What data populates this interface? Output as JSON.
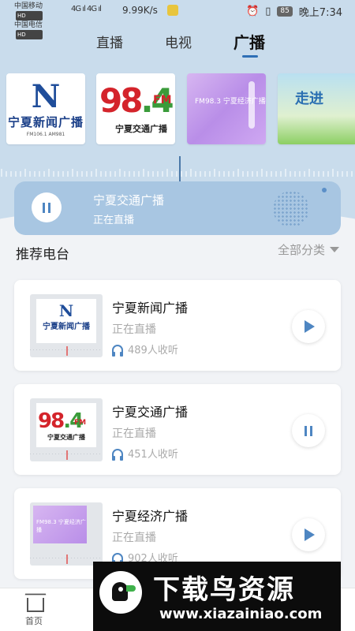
{
  "status_bar": {
    "carrier1": "中国移动",
    "carrier2": "中国电信",
    "hd": "HD",
    "signal": "4G ıl 4G ıl",
    "speed": "9.99K/s",
    "battery": "85",
    "time": "晚上7:34"
  },
  "tabs": [
    {
      "label": "直播"
    },
    {
      "label": "电视"
    },
    {
      "label": "广播",
      "active": true
    }
  ],
  "carousel": {
    "logo1": {
      "mark": "N",
      "text": "宁夏新闻广播",
      "sub": "FM106.1 AM981"
    },
    "logo2": {
      "num_a": "98",
      "num_b": ".4",
      "tag": "FM",
      "text": "宁夏交通广播"
    },
    "logo3": {
      "text": "FM98.3 宁夏经济广播"
    },
    "logo4": {
      "text": "走进"
    }
  },
  "now_playing": {
    "title": "宁夏交通广播",
    "status": "正在直播"
  },
  "section": {
    "title": "推荐电台",
    "filter": "全部分类"
  },
  "stations": [
    {
      "name": "宁夏新闻广播",
      "status": "正在直播",
      "listeners": "489人收听",
      "state": "play"
    },
    {
      "name": "宁夏交通广播",
      "status": "正在直播",
      "listeners": "451人收听",
      "state": "pause"
    },
    {
      "name": "宁夏经济广播",
      "status": "正在直播",
      "listeners": "902人收听",
      "state": "play"
    }
  ],
  "bottom_nav": {
    "home": "首页"
  },
  "watermark": {
    "title": "下载鸟资源",
    "url": "www.xiazainiao.com"
  },
  "colors": {
    "accent": "#4e86c2",
    "header_bg": "#c9dcec",
    "card_bg": "#a8c6e2"
  }
}
